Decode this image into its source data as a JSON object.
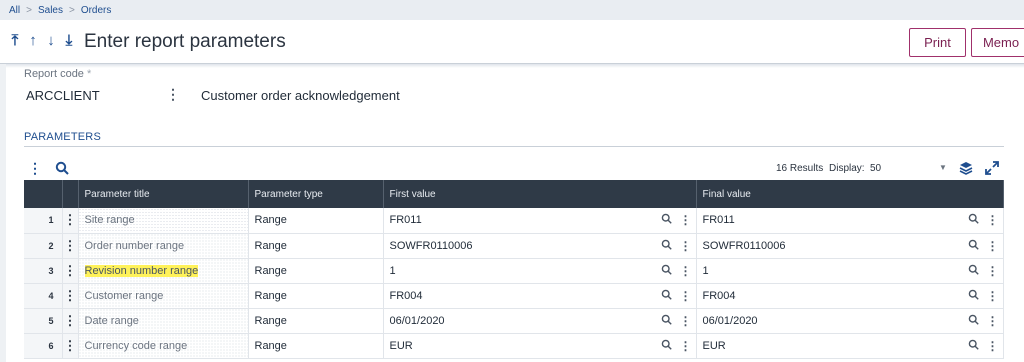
{
  "breadcrumb": [
    "All",
    "Sales",
    "Orders"
  ],
  "header": {
    "title": "Enter report parameters",
    "buttons": {
      "print": "Print",
      "memo": "Memo"
    }
  },
  "report_code": {
    "label": "Report code",
    "required_marker": "*",
    "value": "ARCCLIENT",
    "description": "Customer order acknowledgement"
  },
  "parameters": {
    "section_title": "PARAMETERS",
    "results_text": "16 Results",
    "display_label": "Display:",
    "display_value": "50",
    "columns": [
      "Parameter title",
      "Parameter type",
      "First value",
      "Final value"
    ],
    "rows": [
      {
        "num": "1",
        "title": "Site range",
        "type": "Range",
        "first": "FR011",
        "final": "FR011",
        "highlight": false
      },
      {
        "num": "2",
        "title": "Order number range",
        "type": "Range",
        "first": "SOWFR0110006",
        "final": "SOWFR0110006",
        "highlight": false
      },
      {
        "num": "3",
        "title": "Revision number range",
        "type": "Range",
        "first": "1",
        "final": "1",
        "highlight": true
      },
      {
        "num": "4",
        "title": "Customer range",
        "type": "Range",
        "first": "FR004",
        "final": "FR004",
        "highlight": false
      },
      {
        "num": "5",
        "title": "Date range",
        "type": "Range",
        "first": "06/01/2020",
        "final": "06/01/2020",
        "highlight": false
      },
      {
        "num": "6",
        "title": "Currency code range",
        "type": "Range",
        "first": "EUR",
        "final": "EUR",
        "highlight": false
      }
    ]
  },
  "colors": {
    "accent": "#1f4e8f",
    "header_bg": "#2f3a47",
    "button_border": "#a0306b",
    "highlight": "#fff25a"
  },
  "icons": [
    "chevron-right-icon",
    "first-record-icon",
    "previous-record-icon",
    "next-record-icon",
    "last-record-icon",
    "kebab-menu-icon",
    "search-icon",
    "layers-icon",
    "expand-icon",
    "caret-down-icon"
  ]
}
